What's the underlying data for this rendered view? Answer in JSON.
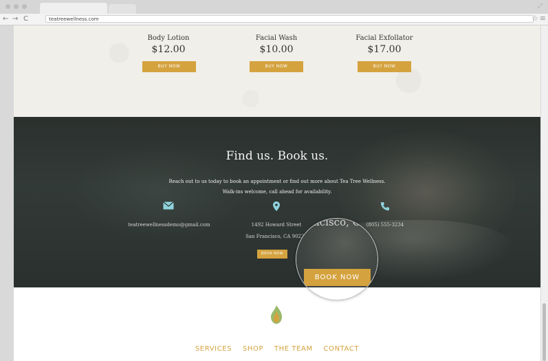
{
  "browser": {
    "url": "teatreewellness.com"
  },
  "products": [
    {
      "name": "Body Lotion",
      "price": "$12.00",
      "button": "BUY NOW"
    },
    {
      "name": "Facial Wash",
      "price": "$10.00",
      "button": "BUY NOW"
    },
    {
      "name": "Facial Exfollator",
      "price": "$17.00",
      "button": "BUY NOW"
    }
  ],
  "findus": {
    "title": "Find us. Book us.",
    "line1": "Reach out to us today to book an appointment or find out more about Tea Tree Wellness.",
    "line2": "Walk-ins welcome, call ahead for availability.",
    "email": "teatreewellnessdemo@gmail.com",
    "address1": "1492 Howard Street",
    "address2": "San Francisco, CA 90227",
    "phone": "(805) 555-3234",
    "book_label": "BOOK NOW"
  },
  "magnifier": {
    "text": "rancisco, CA",
    "book_label": "BOOK NOW"
  },
  "footer": {
    "nav": [
      "SERVICES",
      "SHOP",
      "THE TEAM",
      "CONTACT"
    ]
  },
  "colors": {
    "accent": "#d4a23e",
    "icon": "#8fd3de"
  },
  "icons": {
    "email": "envelope-icon",
    "location": "map-pin-icon",
    "phone": "phone-icon",
    "logo": "leaf-flame-logo"
  }
}
